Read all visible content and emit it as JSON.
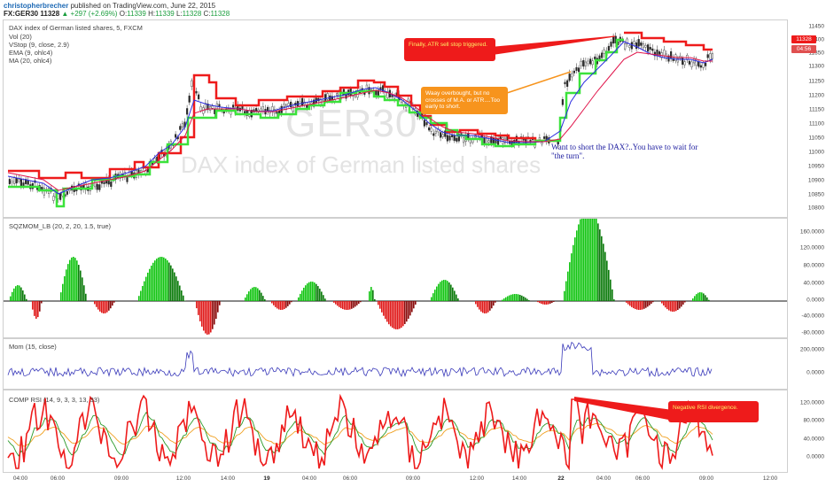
{
  "header": {
    "author": "christopherbrecher",
    "published": "published on TradingView.com, June 22, 2015",
    "symbol": "FX:GER30",
    "last": "11328",
    "change": "▲ +297 (+2.69%)",
    "o_label": "O:",
    "o_val": "11339",
    "h_label": "H:",
    "h_val": "11339",
    "l_label": "L:",
    "l_val": "11328",
    "c_label": "C:",
    "c_val": "11328"
  },
  "main_pane": {
    "title": "DAX index of German listed shares, 5, FXCM",
    "indicators": [
      "Vol (20)",
      "VStop (9, close, 2.9)",
      "EMA (9, ohlc4)",
      "MA (20, ohlc4)"
    ],
    "watermark_symbol": "GER30",
    "watermark_desc": "DAX index of German listed shares",
    "y_ticks": [
      "11450",
      "11400",
      "11350",
      "11300",
      "11250",
      "11200",
      "11150",
      "11100",
      "11050",
      "11000",
      "10950",
      "10900",
      "10850",
      "10800"
    ],
    "price_tag": "11328",
    "time_tag": "04:56",
    "callout_1": "Finally, ATR sell stop triggered.",
    "callout_2": "Waay overbought, but no crosses of M.A. or ATR....Too early to short.",
    "annotation": "Want to short the DAX?..You have to wait for \"the turn\"."
  },
  "sqz_pane": {
    "title": "SQZMOM_LB (20, 2, 20, 1.5, true)",
    "y_ticks": [
      "160.0000",
      "120.0000",
      "80.0000",
      "40.0000",
      "0.0000",
      "-40.0000",
      "-80.0000"
    ]
  },
  "mom_pane": {
    "title": "Mom (15, close)",
    "y_ticks": [
      "200.0000",
      "0.0000"
    ]
  },
  "rsi_pane": {
    "title": "COMP RSI (14, 9, 3, 3, 13, 33)",
    "y_ticks": [
      "120.0000",
      "80.0000",
      "40.0000",
      "0.0000"
    ],
    "callout": "Negative RSI divergence."
  },
  "x_axis": [
    "04:00",
    "06:00",
    "09:00",
    "12:00",
    "14:00",
    "19",
    "04:00",
    "06:00",
    "09:00",
    "12:00",
    "14:00",
    "22",
    "04:00",
    "06:00",
    "09:00",
    "12:00"
  ],
  "colors": {
    "up_candle": "#2a2a2a",
    "stop_red": "#ee1b1b",
    "stop_green": "#3be23b",
    "ema": "#2d2de0",
    "ma": "#e0144a",
    "sqz_green": "#0fae0f",
    "sqz_red": "#c90f0f",
    "mom": "#3a3aba",
    "rsi": "#ee1b1b"
  }
}
